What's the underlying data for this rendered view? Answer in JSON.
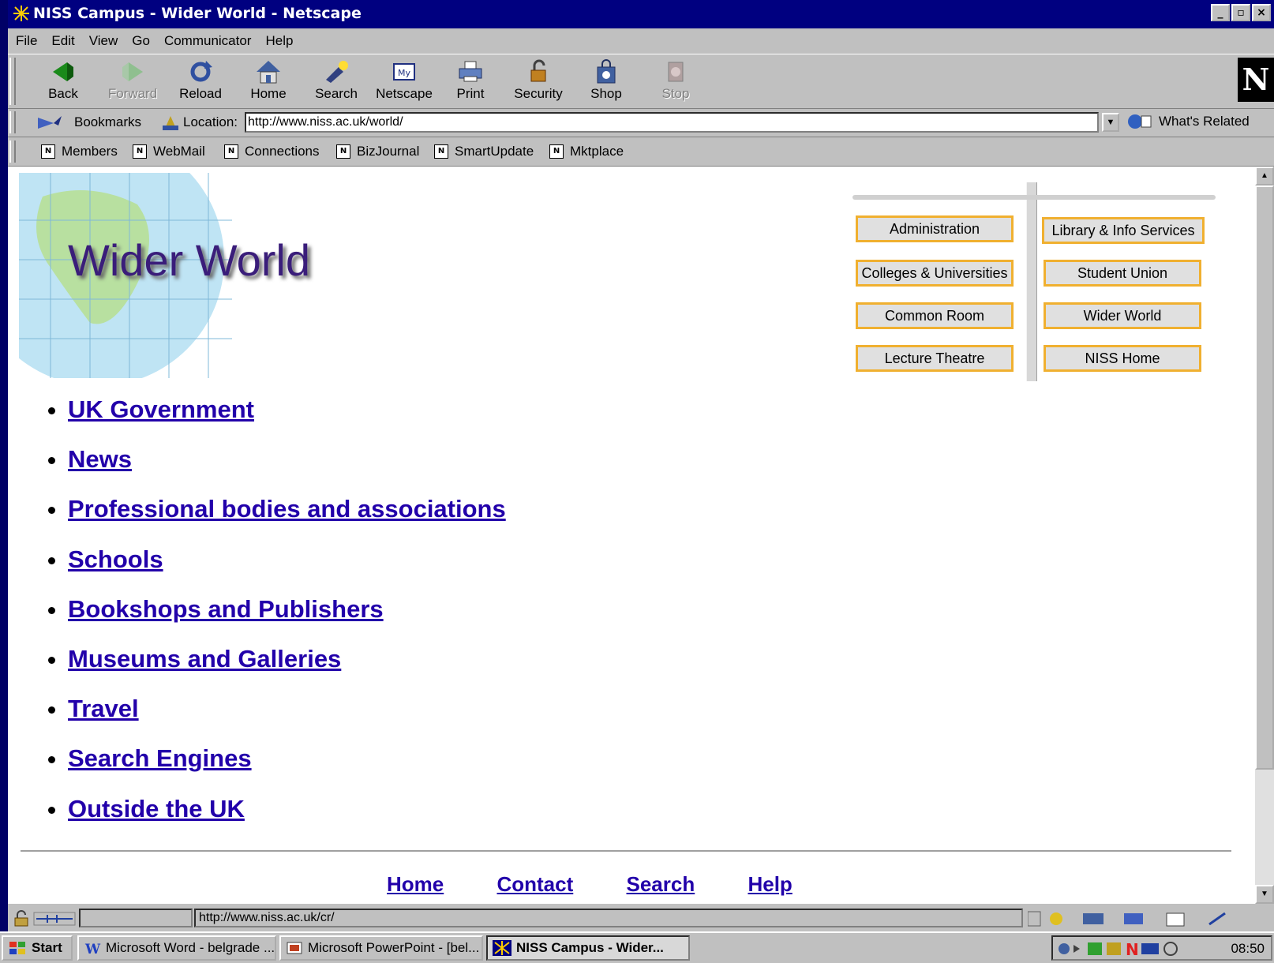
{
  "window": {
    "title": "NISS Campus - Wider World - Netscape",
    "btn_min": "_",
    "btn_max": "▫",
    "btn_close": "×"
  },
  "menu": {
    "items": [
      "File",
      "Edit",
      "View",
      "Go",
      "Communicator",
      "Help"
    ]
  },
  "toolbar": {
    "back": "Back",
    "forward": "Forward",
    "reload": "Reload",
    "home": "Home",
    "search": "Search",
    "netscape": "Netscape",
    "print": "Print",
    "security": "Security",
    "shop": "Shop",
    "stop": "Stop",
    "logo": "N"
  },
  "location_bar": {
    "bookmarks": "Bookmarks",
    "location_label": "Location:",
    "url": "http://www.niss.ac.uk/world/",
    "whats_related": "What's Related"
  },
  "personal_toolbar": {
    "items": [
      "Members",
      "WebMail",
      "Connections",
      "BizJournal",
      "SmartUpdate",
      "Mktplace"
    ]
  },
  "page": {
    "title": "Wider World",
    "signpost": {
      "left": [
        "Administration",
        "Colleges & Universities",
        "Common Room",
        "Lecture Theatre"
      ],
      "right": [
        "Library & Info Services",
        "Student Union",
        "Wider World",
        "NISS Home"
      ]
    },
    "links": [
      "UK Government",
      "News",
      "Professional bodies and associations ",
      "Schools",
      "Bookshops and Publishers",
      "Museums and Galleries",
      "Travel",
      "Search Engines",
      "Outside the UK "
    ],
    "footer_links": [
      "Home",
      "Contact",
      "Search",
      "Help"
    ]
  },
  "status": {
    "url": "http://www.niss.ac.uk/cr/"
  },
  "taskbar": {
    "start": "Start",
    "tasks": [
      "Microsoft Word - belgrade ...",
      "Microsoft PowerPoint - [bel...",
      "NISS Campus - Wider..."
    ],
    "clock": "08:50"
  },
  "colors": {
    "title_bar": "#000080",
    "link": "#2200aa",
    "heading": "#3a1d7a",
    "sign_border": "#f0b030"
  }
}
